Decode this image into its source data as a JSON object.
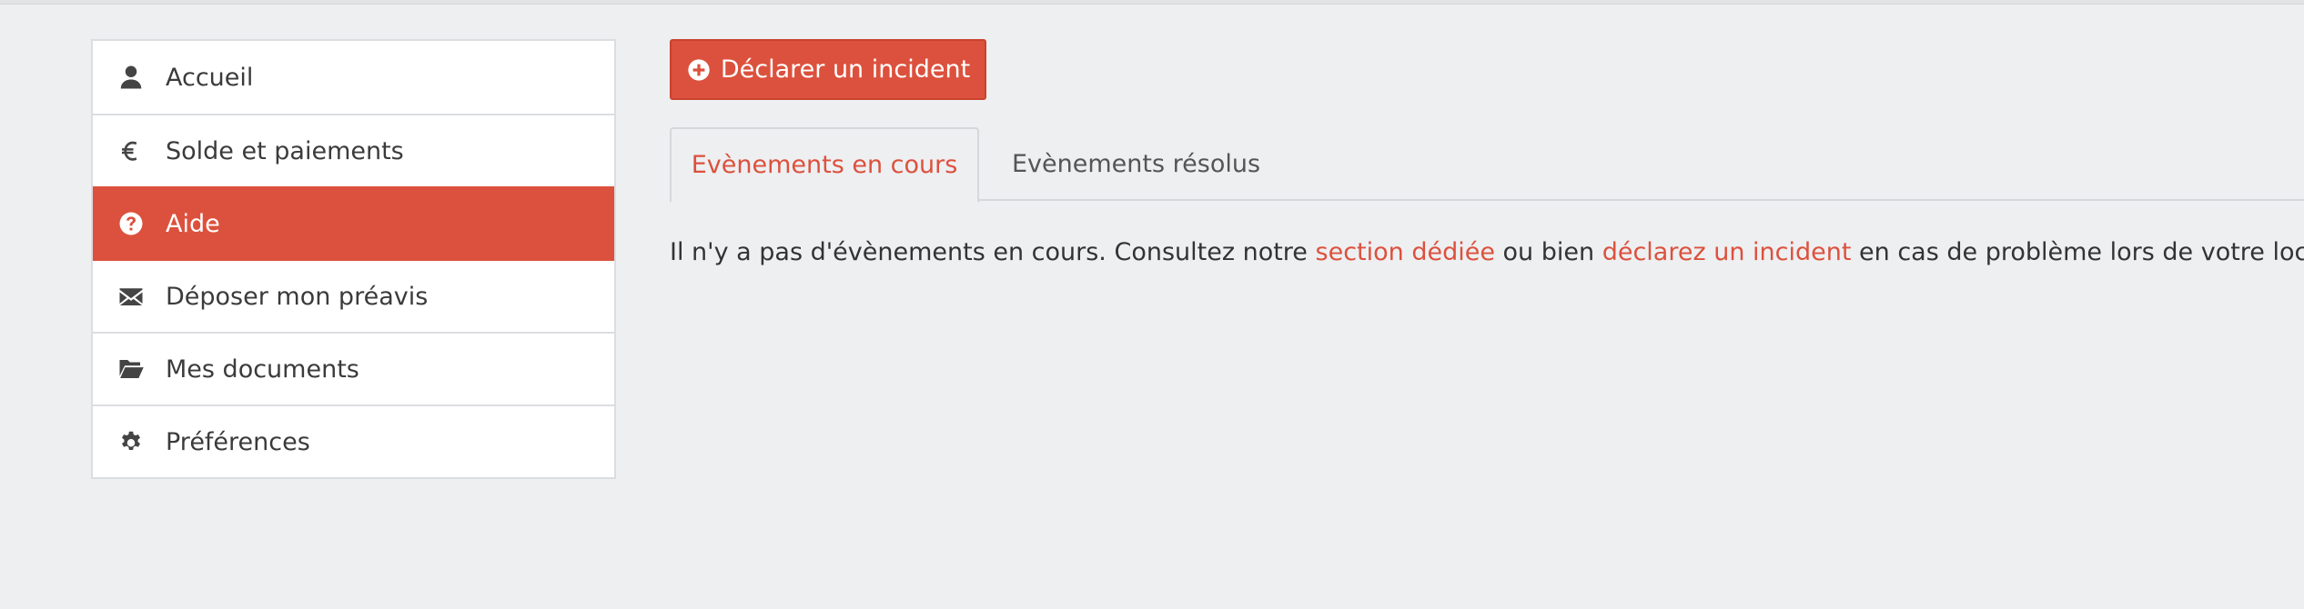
{
  "sidebar": {
    "items": [
      {
        "label": "Accueil",
        "icon": "user-icon"
      },
      {
        "label": "Solde et paiements",
        "icon": "euro-icon"
      },
      {
        "label": "Aide",
        "icon": "help-circle-icon",
        "active": true
      },
      {
        "label": "Déposer mon préavis",
        "icon": "envelope-icon"
      },
      {
        "label": "Mes documents",
        "icon": "folder-open-icon"
      },
      {
        "label": "Préférences",
        "icon": "gear-icon"
      }
    ]
  },
  "main": {
    "declare_button": {
      "label": "Déclarer un incident",
      "icon": "plus-circle-icon"
    },
    "tabs": [
      {
        "label": "Evènements en cours",
        "active": true
      },
      {
        "label": "Evènements résolus",
        "active": false
      }
    ],
    "message": {
      "part1": "Il n'y a pas d'évènements en cours. Consultez notre ",
      "link1": "section dédiée",
      "part2": " ou bien ",
      "link2": "déclarez un incident",
      "part3": " en cas de problème lors de votre location."
    }
  },
  "colors": {
    "accent": "#dc513d",
    "background": "#eeeff1",
    "border": "#dcdde0"
  }
}
